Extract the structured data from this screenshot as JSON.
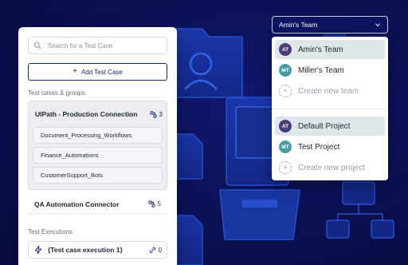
{
  "colors": {
    "background": "#0b1258",
    "accent_navy": "#1b2770",
    "avatar_purple": "#4b3c7a",
    "avatar_teal": "#4a9ca0",
    "selected_bg": "#dde7ea"
  },
  "test_cases_panel": {
    "search": {
      "placeholder": "Search for a Test Case",
      "icon": "search-icon"
    },
    "add_button": {
      "label": "Add Test Case",
      "icon": "plus-icon"
    },
    "groups_section_label": "Test cases & groups",
    "groups": [
      {
        "name": "UIPath - Production Connection",
        "count": "3",
        "count_icon": "test-cases-icon",
        "expanded": true,
        "children": [
          "Document_Processing_Workflows",
          "Finance_Automations",
          "CustomerSupport_Bots"
        ]
      },
      {
        "name": "QA Automation Connector",
        "count": "5",
        "count_icon": "test-cases-icon",
        "expanded": false
      }
    ],
    "executions_section_label": "Test Executions",
    "executions": [
      {
        "name": "{Test case execution 1}",
        "count": "0",
        "icon": "bolt-icon",
        "count_icon": "link-icon"
      }
    ]
  },
  "team_switcher": {
    "selected_team": "Amin's Team",
    "icon": "chevron-down-icon",
    "teams": [
      {
        "initials": "AT",
        "name": "Amin's Team",
        "selected": true,
        "avatar_color": "#4b3c7a"
      },
      {
        "initials": "MT",
        "name": "Miller's Team",
        "selected": false,
        "avatar_color": "#4a9ca0"
      }
    ],
    "create_team_label": "Create new team",
    "projects": [
      {
        "initials": "AT",
        "name": "Default Project",
        "selected": true,
        "avatar_color": "#4b3c7a"
      },
      {
        "initials": "MT",
        "name": "Test Project",
        "selected": false,
        "avatar_color": "#4a9ca0"
      }
    ],
    "create_project_label": "Create new project"
  }
}
